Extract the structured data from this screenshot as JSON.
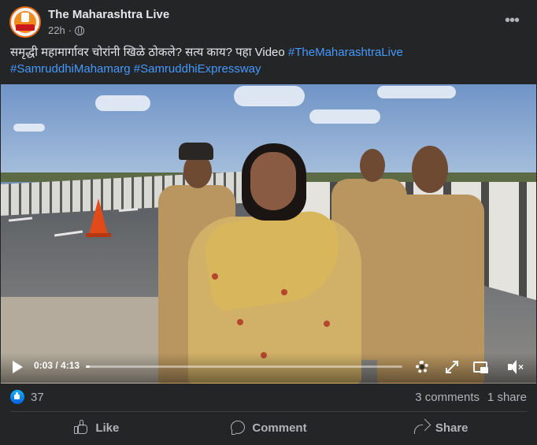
{
  "post": {
    "page_name": "The Maharashtra Live",
    "time": "22h",
    "separator": "·",
    "audience_icon": "globe-icon",
    "more_icon": "more-options-icon",
    "more_glyph": "•••",
    "caption_text": "समृद्धी महामार्गावर चोरांनी खिळे ठोकले? सत्य काय? पहा Video ",
    "hashtags": [
      "#TheMaharashtraLive",
      "#SamruddhiMahamarg",
      "#SamruddhiExpressway"
    ]
  },
  "video": {
    "current_time": "0:03",
    "duration": "4:13",
    "time_display": "0:03 / 4:13",
    "progress_fraction": 0.012,
    "controls": [
      "play-icon",
      "settings-icon",
      "fullscreen-icon",
      "picture-in-picture-icon",
      "mute-icon"
    ],
    "mute_glyph": "×"
  },
  "stats": {
    "reaction_count": "37",
    "comments": "3 comments",
    "shares": "1 share"
  },
  "actions": {
    "like": "Like",
    "comment": "Comment",
    "share": "Share"
  },
  "colors": {
    "background": "#242526",
    "text_primary": "#e4e6eb",
    "text_secondary": "#b0b3b8",
    "hashtag": "#4599ff",
    "reaction_blue": "#0866ff"
  }
}
